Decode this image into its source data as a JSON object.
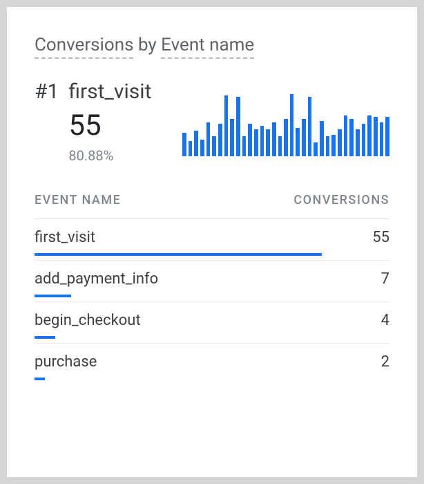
{
  "title": {
    "metric": "Conversions",
    "by": "by",
    "dimension": "Event name"
  },
  "hero": {
    "rank": "#1",
    "event": "first_visit",
    "value": "55",
    "percent": "80.88%"
  },
  "table": {
    "header_name": "EVENT NAME",
    "header_value": "CONVERSIONS",
    "rows": [
      {
        "name": "first_visit",
        "value": "55",
        "bar_pct": 80.88
      },
      {
        "name": "add_payment_info",
        "value": "7",
        "bar_pct": 10.29
      },
      {
        "name": "begin_checkout",
        "value": "4",
        "bar_pct": 5.88
      },
      {
        "name": "purchase",
        "value": "2",
        "bar_pct": 2.94
      }
    ]
  },
  "chart_data": {
    "type": "bar",
    "title": "Conversions by Event name",
    "series": [
      {
        "name": "first_visit",
        "values": [
          55
        ]
      },
      {
        "name": "add_payment_info",
        "values": [
          7
        ]
      },
      {
        "name": "begin_checkout",
        "values": [
          4
        ]
      },
      {
        "name": "purchase",
        "values": [
          2
        ]
      }
    ],
    "sparkline": {
      "type": "bar",
      "values": [
        35,
        22,
        38,
        25,
        50,
        30,
        48,
        90,
        55,
        88,
        30,
        48,
        40,
        45,
        40,
        50,
        30,
        55,
        92,
        42,
        55,
        88,
        20,
        52,
        30,
        32,
        40,
        60,
        55,
        40,
        48,
        60,
        58,
        50,
        58
      ]
    }
  },
  "colors": {
    "accent": "#1a73e8"
  }
}
